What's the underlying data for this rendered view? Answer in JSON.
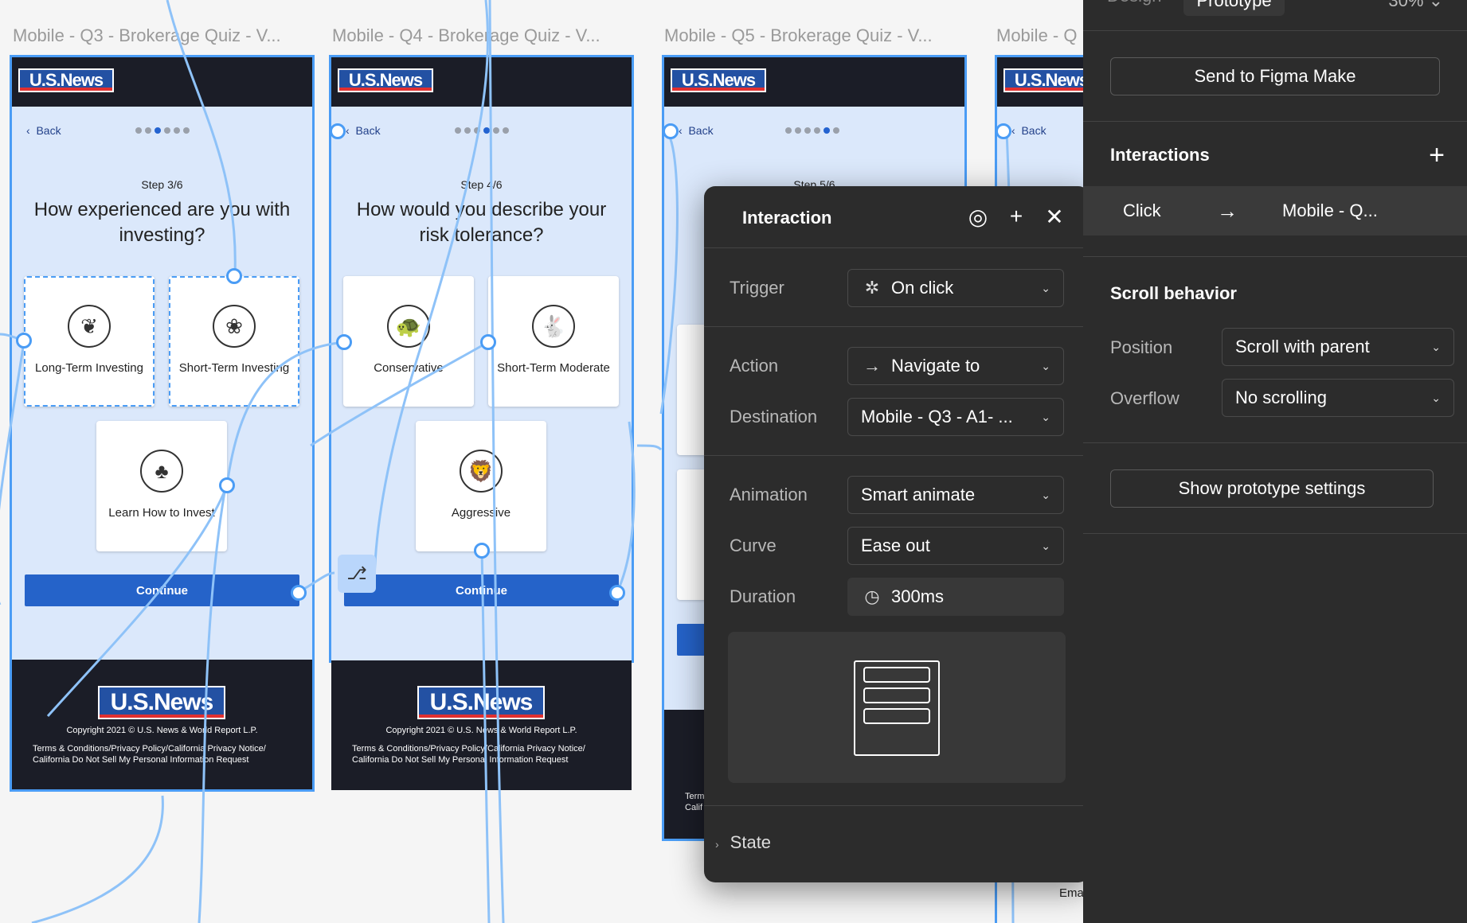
{
  "canvas": {
    "frames": [
      {
        "title": "Mobile - Q3 - Brokerage Quiz - V...",
        "back": "Back",
        "step": "Step 3/6",
        "question": "How experienced are you with investing?",
        "options": [
          "Long-Term Investing",
          "Short-Term Investing",
          "Learn How to Invest"
        ],
        "continue": "Continue",
        "copyright": "Copyright 2021 © U.S. News & World Report L.P.",
        "terms": "Terms & Conditions/Privacy Policy/California Privacy Notice/ California Do Not Sell My Personal Information Request"
      },
      {
        "title": "Mobile - Q4 - Brokerage Quiz - V...",
        "back": "Back",
        "step": "Step 4/6",
        "question": "How would you describe your risk tolerance?",
        "options": [
          "Conservative",
          "Short-Term Moderate",
          "Aggressive"
        ],
        "continue": "Continue",
        "copyright": "Copyright 2021 © U.S. News & World Report L.P.",
        "terms": "Terms & Conditions/Privacy Policy/California Privacy Notice/ California Do Not Sell My Personal Information Request"
      },
      {
        "title": "Mobile - Q5 - Brokerage Quiz - V...",
        "back": "Back",
        "step": "Step 5/6",
        "partial_terms": "Term Calif"
      },
      {
        "title": "Mobile - Q",
        "back": "Back",
        "footer_text": "Ema"
      }
    ],
    "logo_text": "U.S.News"
  },
  "interaction_popover": {
    "title": "Interaction",
    "trigger_label": "Trigger",
    "trigger_value": "On click",
    "action_label": "Action",
    "action_value": "Navigate to",
    "destination_label": "Destination",
    "destination_value": "Mobile - Q3 - A1- ...",
    "animation_label": "Animation",
    "animation_value": "Smart animate",
    "curve_label": "Curve",
    "curve_value": "Ease out",
    "duration_label": "Duration",
    "duration_value": "300ms",
    "state_label": "State"
  },
  "panel": {
    "tabs": [
      "Design",
      "Prototype"
    ],
    "zoom": "30%",
    "send_button": "Send to Figma Make",
    "interactions_heading": "Interactions",
    "interaction_row": {
      "trigger": "Click",
      "destination": "Mobile - Q..."
    },
    "scroll_heading": "Scroll behavior",
    "position_label": "Position",
    "position_value": "Scroll with parent",
    "overflow_label": "Overflow",
    "overflow_value": "No scrolling",
    "settings_button": "Show prototype settings"
  },
  "colors": {
    "accent": "#4a9cf5",
    "frame_bg": "#dbe8fb",
    "button_blue": "#2563c9",
    "panel_bg": "#2c2c2c",
    "logo_red": "#e13030"
  }
}
